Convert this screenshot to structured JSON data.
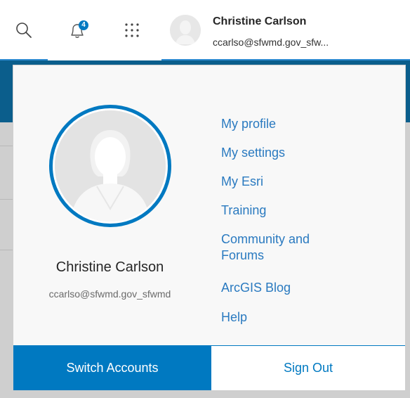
{
  "header": {
    "search_icon": "search-icon",
    "notifications_icon": "bell-icon",
    "notifications_count": "4",
    "apps_icon": "apps-grid-icon",
    "user_name": "Christine Carlson",
    "user_email": "ccarlso@sfwmd.gov_sfw..."
  },
  "panel": {
    "name": "Christine Carlson",
    "email": "ccarlso@sfwmd.gov_sfwmd",
    "links": [
      {
        "label": "My profile"
      },
      {
        "label": "My settings"
      },
      {
        "label": "My Esri"
      },
      {
        "label": "Training"
      },
      {
        "label": "Community and"
      },
      {
        "label": "Forums"
      },
      {
        "label": "ArcGIS Blog"
      },
      {
        "label": "Help"
      }
    ],
    "switch_accounts": "Switch Accounts",
    "sign_out": "Sign Out"
  },
  "colors": {
    "accent": "#0079c1",
    "link": "#2a7ac0",
    "badge": "#0079c1"
  }
}
